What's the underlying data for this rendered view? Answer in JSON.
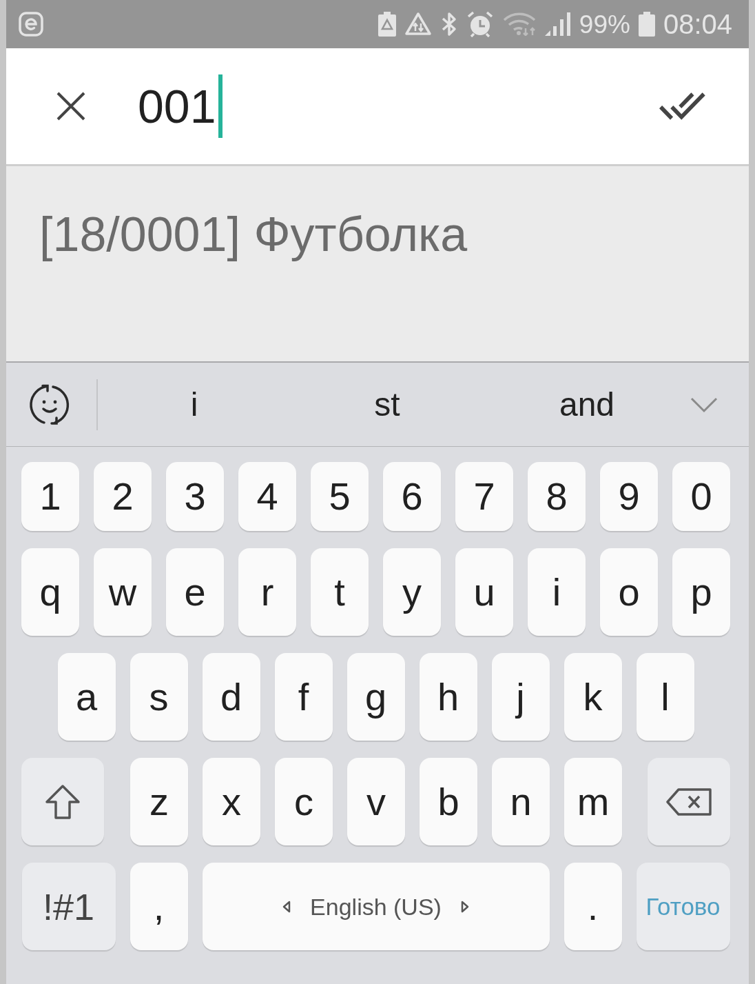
{
  "status_bar": {
    "battery": "99%",
    "time": "08:04"
  },
  "search": {
    "value": "001",
    "focused": true
  },
  "results": [
    {
      "text": "[18/0001] Футболка"
    }
  ],
  "keyboard": {
    "suggestions": [
      "i",
      "st",
      "and"
    ],
    "rows": [
      {
        "keys": [
          {
            "kind": "char",
            "label": "1"
          },
          {
            "kind": "char",
            "label": "2"
          },
          {
            "kind": "char",
            "label": "3"
          },
          {
            "kind": "char",
            "label": "4"
          },
          {
            "kind": "char",
            "label": "5"
          },
          {
            "kind": "char",
            "label": "6"
          },
          {
            "kind": "char",
            "label": "7"
          },
          {
            "kind": "char",
            "label": "8"
          },
          {
            "kind": "char",
            "label": "9"
          },
          {
            "kind": "char",
            "label": "0"
          }
        ]
      },
      {
        "keys": [
          {
            "kind": "char",
            "label": "q"
          },
          {
            "kind": "char",
            "label": "w"
          },
          {
            "kind": "char",
            "label": "e"
          },
          {
            "kind": "char",
            "label": "r"
          },
          {
            "kind": "char",
            "label": "t"
          },
          {
            "kind": "char",
            "label": "y"
          },
          {
            "kind": "char",
            "label": "u"
          },
          {
            "kind": "char",
            "label": "i"
          },
          {
            "kind": "char",
            "label": "o"
          },
          {
            "kind": "char",
            "label": "p"
          }
        ]
      },
      {
        "keys": [
          {
            "kind": "char",
            "label": "a"
          },
          {
            "kind": "char",
            "label": "s"
          },
          {
            "kind": "char",
            "label": "d"
          },
          {
            "kind": "char",
            "label": "f"
          },
          {
            "kind": "char",
            "label": "g"
          },
          {
            "kind": "char",
            "label": "h"
          },
          {
            "kind": "char",
            "label": "j"
          },
          {
            "kind": "char",
            "label": "k"
          },
          {
            "kind": "char",
            "label": "l"
          }
        ]
      },
      {
        "keys": [
          {
            "kind": "shift"
          },
          {
            "kind": "char",
            "label": "z"
          },
          {
            "kind": "char",
            "label": "x"
          },
          {
            "kind": "char",
            "label": "c"
          },
          {
            "kind": "char",
            "label": "v"
          },
          {
            "kind": "char",
            "label": "b"
          },
          {
            "kind": "char",
            "label": "n"
          },
          {
            "kind": "char",
            "label": "m"
          },
          {
            "kind": "backspace"
          }
        ]
      },
      {
        "keys": [
          {
            "kind": "mode",
            "label": "!#1"
          },
          {
            "kind": "char",
            "label": ","
          },
          {
            "kind": "space",
            "label": "English (US)"
          },
          {
            "kind": "char",
            "label": "."
          },
          {
            "kind": "action",
            "label": "Готово"
          }
        ]
      }
    ]
  }
}
